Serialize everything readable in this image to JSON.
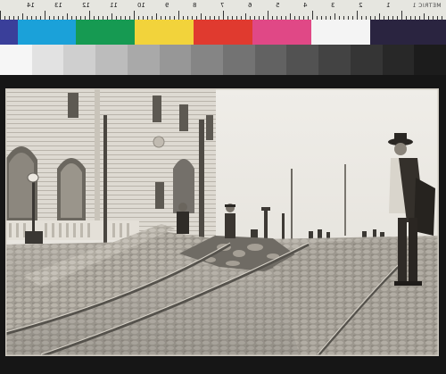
{
  "scan_targets": {
    "ruler_label": "METRIC 1",
    "ruler_numbers": [
      "14",
      "13",
      "12",
      "11",
      "10",
      "9",
      "8",
      "7",
      "6",
      "5",
      "4",
      "3",
      "2",
      "1"
    ],
    "color_patches": [
      "#3a3f9a",
      "#1ba1d9",
      "#169a52",
      "#f2d33b",
      "#e03a2f",
      "#e04886",
      "#f4f4f4",
      "#2a2440"
    ],
    "gray_steps": [
      "#f6f6f6",
      "#e2e2e2",
      "#cfcfcf",
      "#bcbcbc",
      "#a9a9a9",
      "#979797",
      "#858585",
      "#737373",
      "#626262",
      "#525252",
      "#434343",
      "#353535",
      "#282828",
      "#1c1c1c"
    ]
  },
  "photo": {
    "subject": "earthquake-damaged cobblestone street with buckled cable car rails",
    "tone": "sepia-gray"
  }
}
